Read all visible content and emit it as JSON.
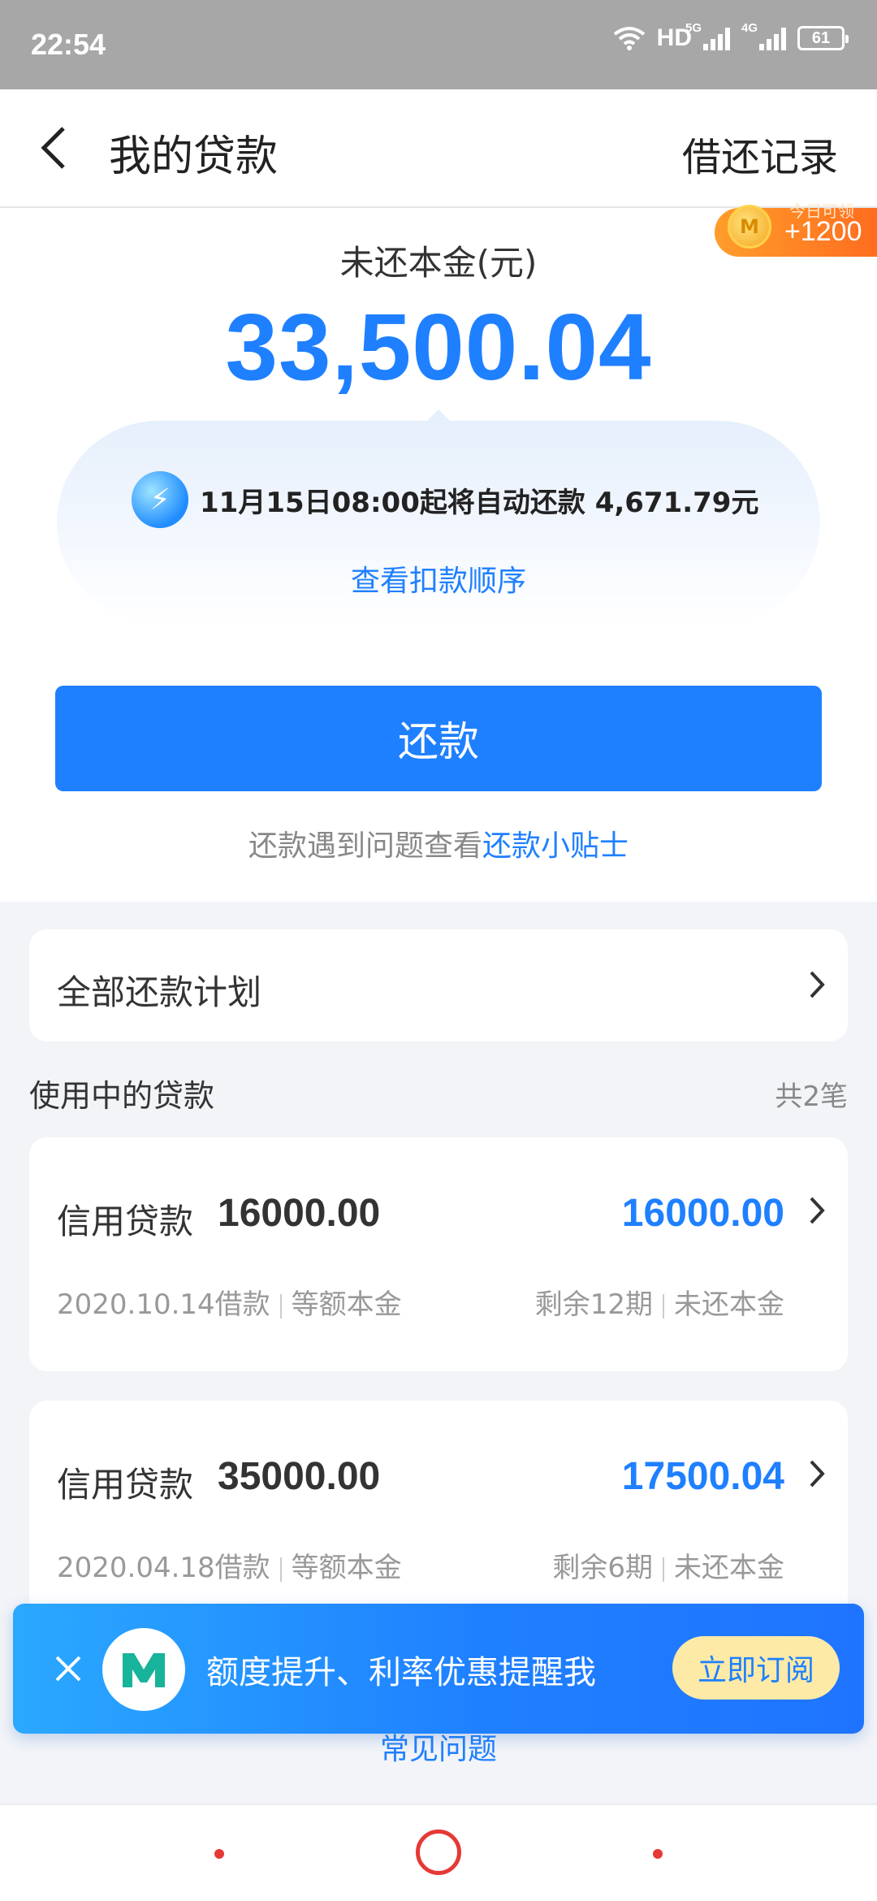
{
  "status_bar": {
    "time": "22:54",
    "hd_label": "HD",
    "sig1_tag": "5G",
    "sig2_tag": "4G",
    "battery": "61"
  },
  "header": {
    "title": "我的贷款",
    "record_link": "借还记录"
  },
  "bonus_badge": {
    "caption": "今日可领",
    "value": "+1200"
  },
  "summary": {
    "principal_label": "未还本金(元)",
    "principal_amount": "33,500.04",
    "auto_repay_notice": "11月15日08:00起将自动还款 4,671.79元",
    "deduction_order_link": "查看扣款顺序",
    "repay_button": "还款",
    "tips_prefix": "还款遇到问题查看",
    "tips_link": "还款小贴士"
  },
  "plan": {
    "label": "全部还款计划"
  },
  "loans_section": {
    "title": "使用中的贷款",
    "count": "共2笔",
    "items": [
      {
        "name": "信用贷款",
        "amount": "16000.00",
        "remaining_principal": "16000.00",
        "borrow_date": "2020.10.14借款",
        "method": "等额本金",
        "periods_left": "剩余12期",
        "remaining_label": "未还本金"
      },
      {
        "name": "信用贷款",
        "amount": "35000.00",
        "remaining_principal": "17500.04",
        "borrow_date": "2020.04.18借款",
        "method": "等额本金",
        "periods_left": "剩余6期",
        "remaining_label": "未还本金"
      }
    ]
  },
  "faq_link": "常见问题",
  "banner": {
    "text": "额度提升、利率优惠提醒我",
    "subscribe_button": "立即订阅"
  },
  "colors": {
    "accent": "#1f80ff",
    "statusbar": "#a7a7a7",
    "page_bg": "#f2f4f8",
    "subscribe_bg": "#fdeaa6",
    "nav_red": "#e53935"
  }
}
